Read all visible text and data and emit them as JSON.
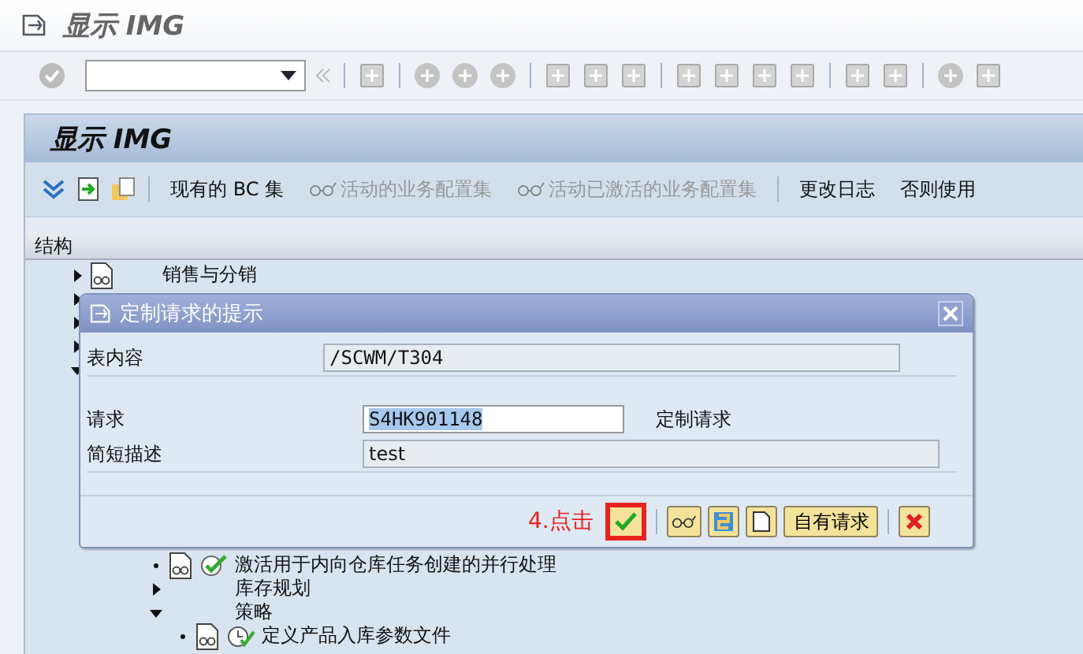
{
  "window": {
    "title": "显示 IMG"
  },
  "screen": {
    "title": "显示 IMG"
  },
  "app_toolbar": [
    {
      "label": "现有的 BC 集",
      "disabled": false,
      "icon": false
    },
    {
      "label": "活动的业务配置集",
      "disabled": true,
      "icon": true
    },
    {
      "label": "活动已激活的业务配置集",
      "disabled": true,
      "icon": true
    },
    {
      "label": "更改日志",
      "disabled": false,
      "icon": false
    },
    {
      "label": "否则使用",
      "disabled": false,
      "icon": false
    }
  ],
  "structure": {
    "heading": "结构",
    "items": [
      {
        "label": "销售与分销",
        "expanded": false,
        "kind": "folder"
      },
      {
        "expanded": false,
        "kind": "folder"
      },
      {
        "expanded": false,
        "kind": "folder"
      },
      {
        "expanded": false,
        "kind": "folder"
      },
      {
        "expanded": true,
        "kind": "folder",
        "children": [
          {
            "label": "激活用于内向仓库任务创建的并行处理",
            "kind": "activity",
            "done": true
          },
          {
            "label": "库存规划",
            "expanded": false,
            "kind": "folder"
          },
          {
            "label": "策略",
            "expanded": true,
            "kind": "folder",
            "children": [
              {
                "label": "定义产品入库参数文件",
                "kind": "activity",
                "done": false
              }
            ]
          }
        ]
      }
    ]
  },
  "dialog": {
    "title": "定制请求的提示",
    "table_contents": {
      "label": "表内容",
      "value": "/SCWM/T304"
    },
    "request": {
      "label": "请求",
      "value": "S4HK901148",
      "type_label": "定制请求"
    },
    "short_description": {
      "label": "简短描述",
      "value": "test"
    },
    "annotation": "4.点击",
    "own_requests_button": "自有请求"
  }
}
